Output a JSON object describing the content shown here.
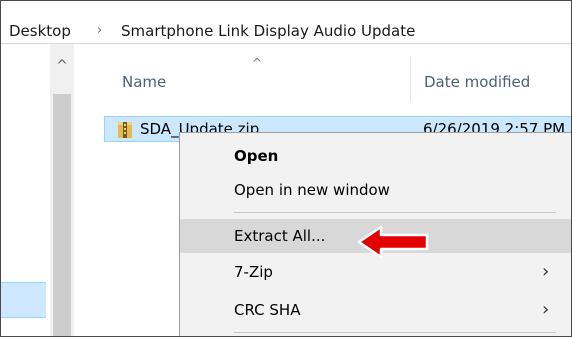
{
  "breadcrumb": {
    "items": [
      "Desktop",
      "Smartphone Link Display Audio Update"
    ],
    "separator": "›"
  },
  "nav": {
    "scroll_up_glyph": "^"
  },
  "columns": {
    "name": "Name",
    "date": "Date modified",
    "sort_glyph": "^"
  },
  "file": {
    "name": "SDA_Update.zip",
    "date": "6/26/2019 2:57 PM"
  },
  "context_menu": {
    "items": [
      {
        "label": "Open"
      },
      {
        "label": "Open in new window"
      },
      {
        "label": "Extract All..."
      },
      {
        "label": "7-Zip"
      },
      {
        "label": "CRC SHA"
      }
    ],
    "chevron": "›"
  },
  "colors": {
    "selection": "#cce8ff",
    "highlight": "#d8d8d8",
    "annotation_arrow": "#e30000"
  }
}
